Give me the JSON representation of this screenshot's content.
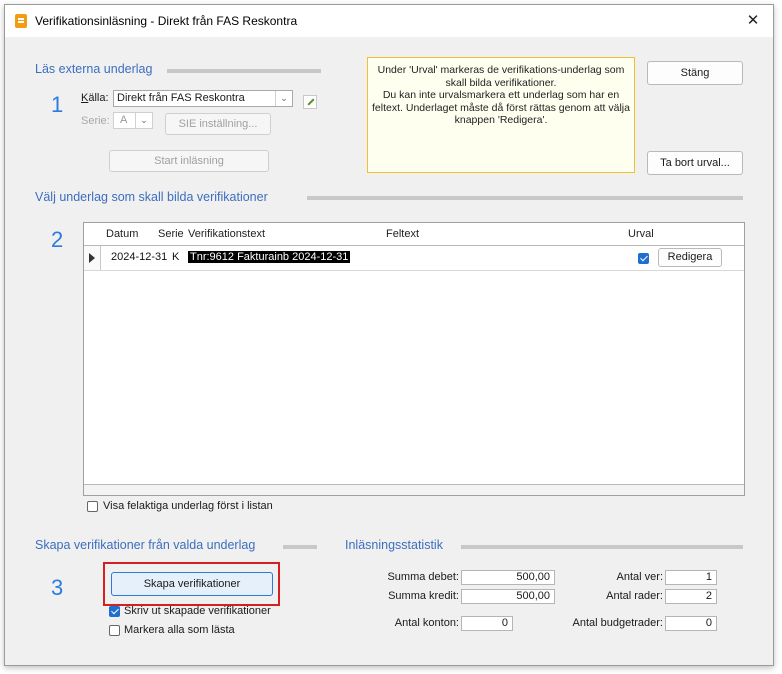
{
  "window": {
    "title": "Verifikationsinläsning - Direkt från FAS Reskontra",
    "close_glyph": "✕"
  },
  "section1": {
    "heading": "Läs externa underlag",
    "step": "1",
    "source_label": "Källa:",
    "source_value": "Direkt från FAS Reskontra",
    "series_label": "Serie:",
    "series_value": "A",
    "sie_button": "SIE inställning...",
    "start_button": "Start inläsning"
  },
  "info_text": [
    "Under 'Urval' markeras de verifikations-underlag som",
    "skall bilda verifikationer.",
    "Du kan inte urvalsmarkera ett underlag som har en",
    "feltext. Underlaget måste då först rättas genom att välja",
    "knappen 'Redigera'."
  ],
  "buttons": {
    "close": "Stäng",
    "remove_selection": "Ta bort urval..."
  },
  "section2": {
    "heading": "Välj underlag som skall bilda verifikationer",
    "step": "2",
    "columns": {
      "date": "Datum",
      "series": "Serie",
      "text": "Verifikationstext",
      "error": "Feltext",
      "selection": "Urval"
    },
    "rows": [
      {
        "date": "2024-12-31",
        "series": "K",
        "text": "Tnr:9612 Fakturainb 2024-12-31",
        "error": "",
        "selected": true,
        "edit_label": "Redigera"
      }
    ],
    "show_errors_first": "Visa felaktiga underlag först i listan"
  },
  "section3": {
    "heading": "Skapa verifikationer från valda underlag",
    "step": "3",
    "create_button": "Skapa verifikationer",
    "print_checkbox": "Skriv ut skapade verifikationer",
    "print_checked": true,
    "mark_all_checkbox": "Markera alla som lästa",
    "mark_all_checked": false
  },
  "stats": {
    "heading": "Inläsningsstatistik",
    "sum_debit_label": "Summa debet:",
    "sum_debit": "500,00",
    "sum_credit_label": "Summa kredit:",
    "sum_credit": "500,00",
    "account_count_label": "Antal konton:",
    "account_count": "0",
    "ver_count_label": "Antal ver:",
    "ver_count": "1",
    "row_count_label": "Antal rader:",
    "row_count": "2",
    "budget_rows_label": "Antal budgetrader:",
    "budget_rows": "0"
  }
}
